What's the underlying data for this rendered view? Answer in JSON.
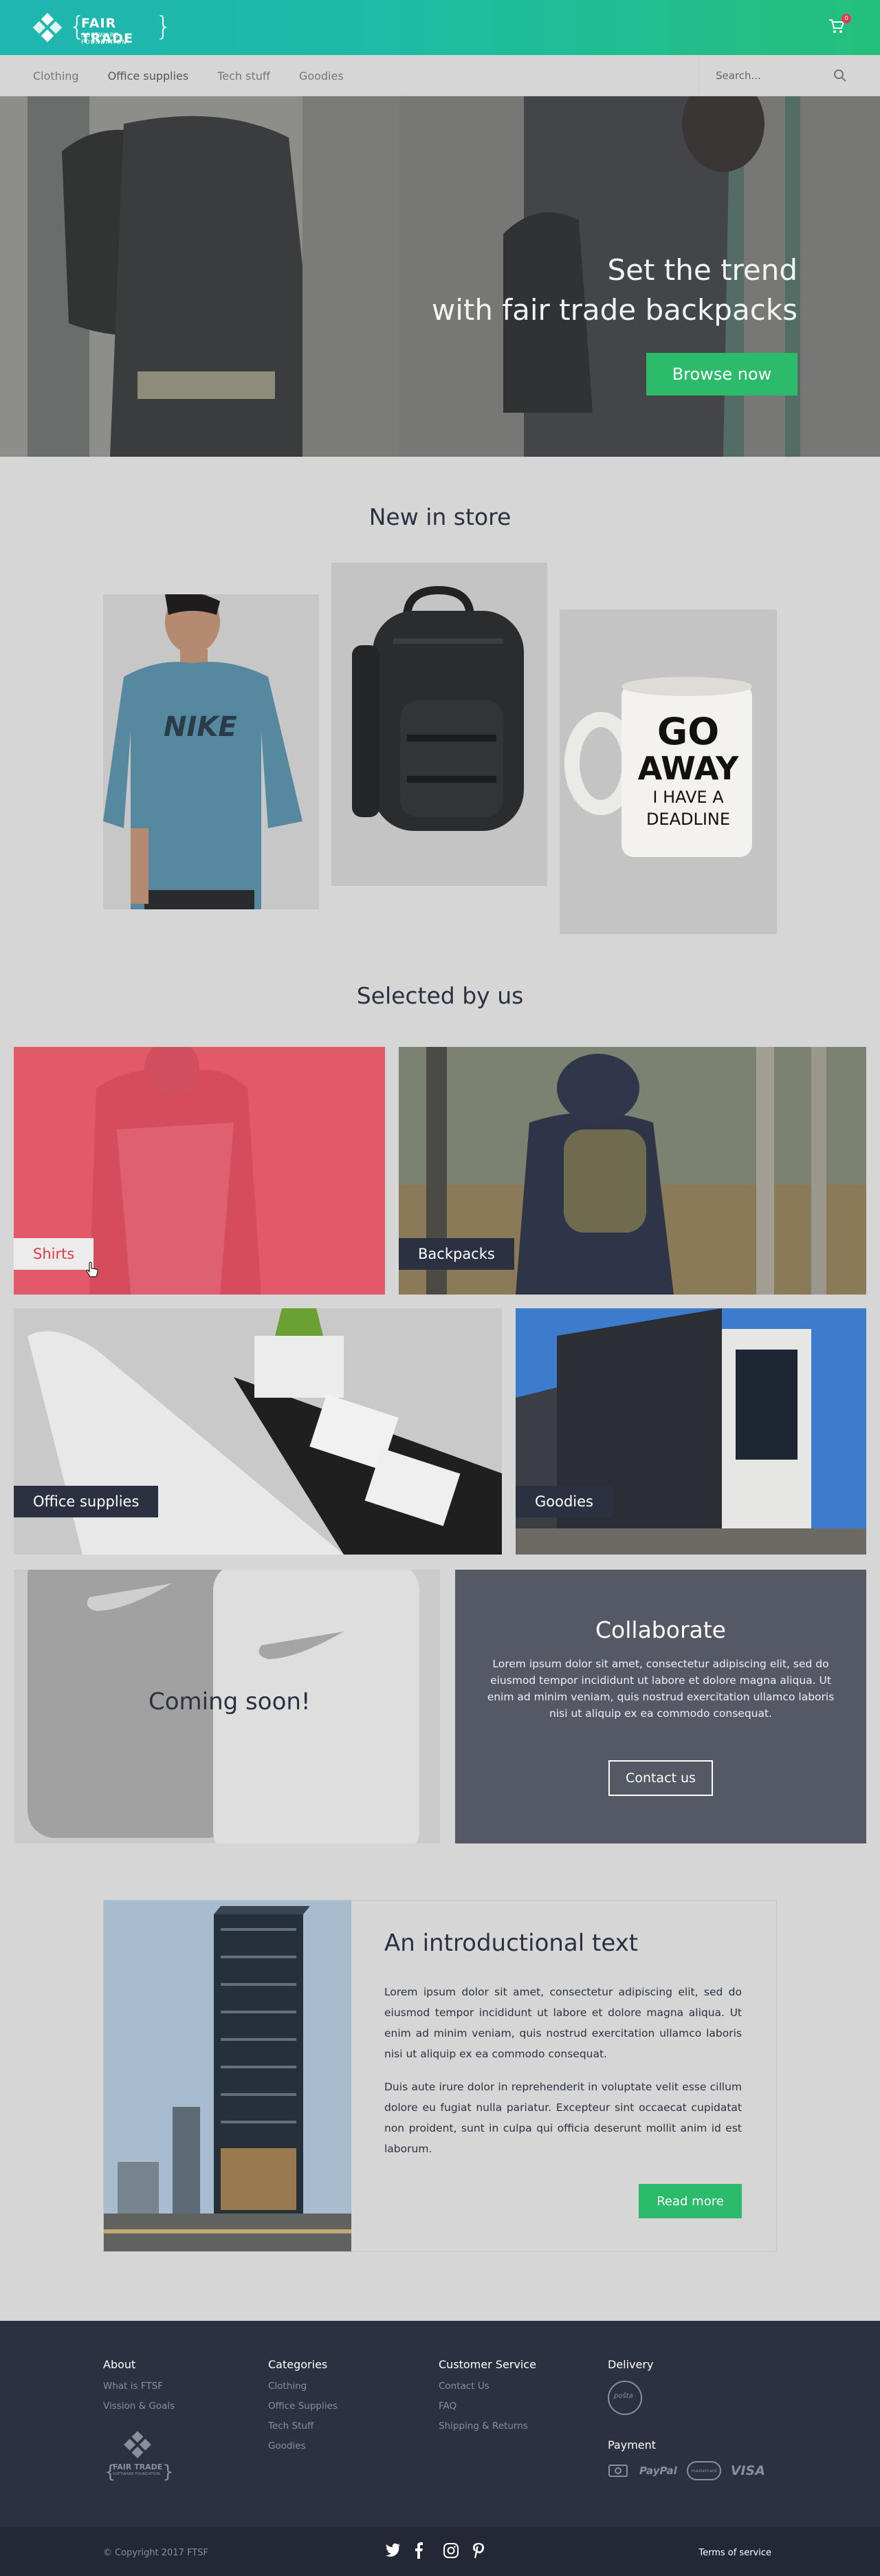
{
  "header": {
    "logo_name": "FAIR TRADE",
    "logo_sub": "SOFTWARE FOUNDATION",
    "cart_count": "0"
  },
  "nav": {
    "items": [
      "Clothing",
      "Office supplies",
      "Tech stuff",
      "Goodies"
    ],
    "search_placeholder": "Search..."
  },
  "hero": {
    "title_line1": "Set the trend",
    "title_line2": "with fair trade backpacks",
    "button": "Browse now"
  },
  "new_in_store": {
    "title": "New in store",
    "mug_text": [
      "GO",
      "AWAY",
      "I HAVE A",
      "DEADLINE"
    ],
    "shirt_text": "NIKE"
  },
  "selected": {
    "title": "Selected by us",
    "tiles": [
      "Shirts",
      "Backpacks",
      "Office supplies",
      "Goodies"
    ],
    "coming_soon": "Coming soon!"
  },
  "collaborate": {
    "title": "Collaborate",
    "text": "Lorem ipsum dolor sit amet, consectetur adipiscing elit, sed do eiusmod tempor incididunt ut labore et dolore magna aliqua. Ut enim ad minim veniam, quis nostrud exercitation ullamco laboris nisi ut aliquip ex ea commodo consequat.",
    "button": "Contact us"
  },
  "intro": {
    "title": "An introductional text",
    "p1": "Lorem ipsum dolor sit amet, consectetur adipiscing elit, sed do eiusmod tempor incididunt ut labore et dolore magna aliqua. Ut enim ad minim veniam, quis nostrud exercitation ullamco laboris nisi ut aliquip ex ea commodo consequat.",
    "p2": "Duis aute irure dolor in reprehenderit in voluptate velit esse cillum dolore eu fugiat nulla pariatur. Excepteur sint occaecat cupidatat non proident, sunt in culpa qui officia deserunt mollit anim id est laborum.",
    "button": "Read more"
  },
  "footer": {
    "about": {
      "title": "About",
      "links": [
        "What is FTSF",
        "Vission & Goals"
      ]
    },
    "categories": {
      "title": "Categories",
      "links": [
        "Clothing",
        "Office Supplies",
        "Tech  Stuff",
        "Goodies"
      ]
    },
    "service": {
      "title": "Customer Service",
      "links": [
        "Contact Us",
        "FAQ",
        "Shipping & Returns"
      ]
    },
    "delivery": {
      "title": "Delivery",
      "carrier": "pošta"
    },
    "payment": {
      "title": "Payment",
      "methods": [
        "PayPal",
        "mastercard",
        "VISA"
      ]
    },
    "copyright": "© Copyright 2017 FTSF",
    "terms": "Terms of service"
  },
  "colors": {
    "accent_green": "#2bbb6a",
    "header_teal": "#1fb5b0",
    "navy": "#2c3142",
    "shirts_tint": "#e25a6a",
    "badge_red": "#e03b4b"
  }
}
